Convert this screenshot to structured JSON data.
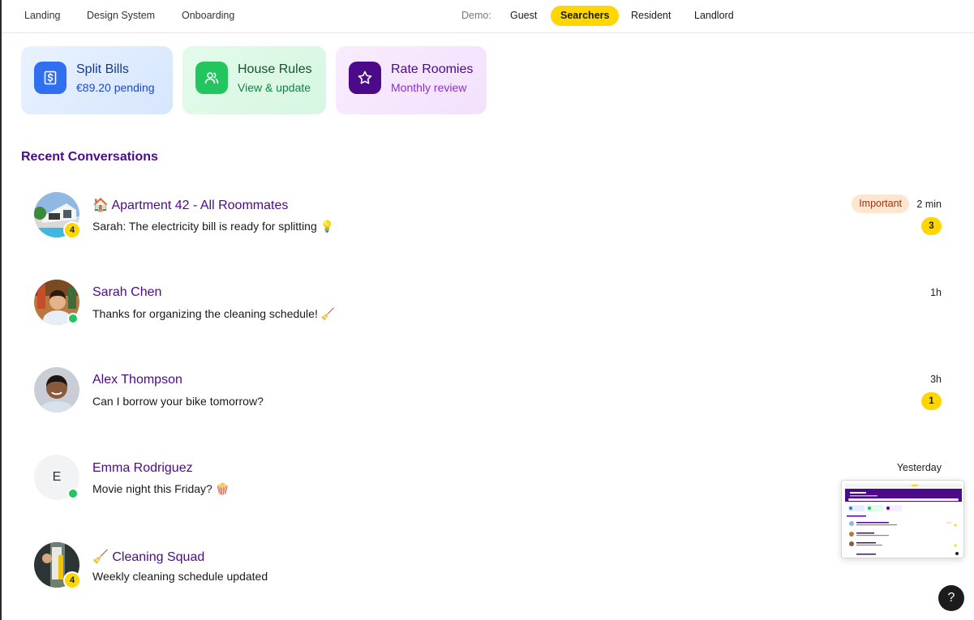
{
  "nav": {
    "links": [
      "Landing",
      "Design System",
      "Onboarding"
    ],
    "demo_label": "Demo:",
    "demo_options": [
      "Guest",
      "Searchers",
      "Resident",
      "Landlord"
    ],
    "active_demo": "Searchers"
  },
  "cards": {
    "bills": {
      "title": "Split Bills",
      "sub": "€89.20 pending",
      "icon": "dollar-receipt-icon"
    },
    "rules": {
      "title": "House Rules",
      "sub": "View & update",
      "icon": "users-icon"
    },
    "rate": {
      "title": "Rate Roomies",
      "sub": "Monthly review",
      "icon": "star-icon"
    }
  },
  "section_title": "Recent Conversations",
  "conversations": [
    {
      "name": "🏠 Apartment 42 - All Roommates",
      "message": "Sarah: The electricity bill is ready for splitting 💡",
      "time": "2 min",
      "tag": "Important",
      "unread": "3",
      "member_count": "4"
    },
    {
      "name": "Sarah Chen",
      "message": "Thanks for organizing the cleaning schedule! 🧹",
      "time": "1h"
    },
    {
      "name": "Alex Thompson",
      "message": "Can I borrow your bike tomorrow?",
      "time": "3h",
      "unread": "1"
    },
    {
      "name": "Emma Rodriguez",
      "message": "Movie night this Friday? 🍿",
      "time": "Yesterday",
      "initial": "E"
    },
    {
      "name": "🧹 Cleaning Squad",
      "message": "Weekly cleaning schedule updated",
      "member_count": "4"
    }
  ],
  "help_label": "?",
  "colors": {
    "accent": "#ffd600",
    "brand": "#4c0a8a",
    "online": "#22c55e"
  }
}
